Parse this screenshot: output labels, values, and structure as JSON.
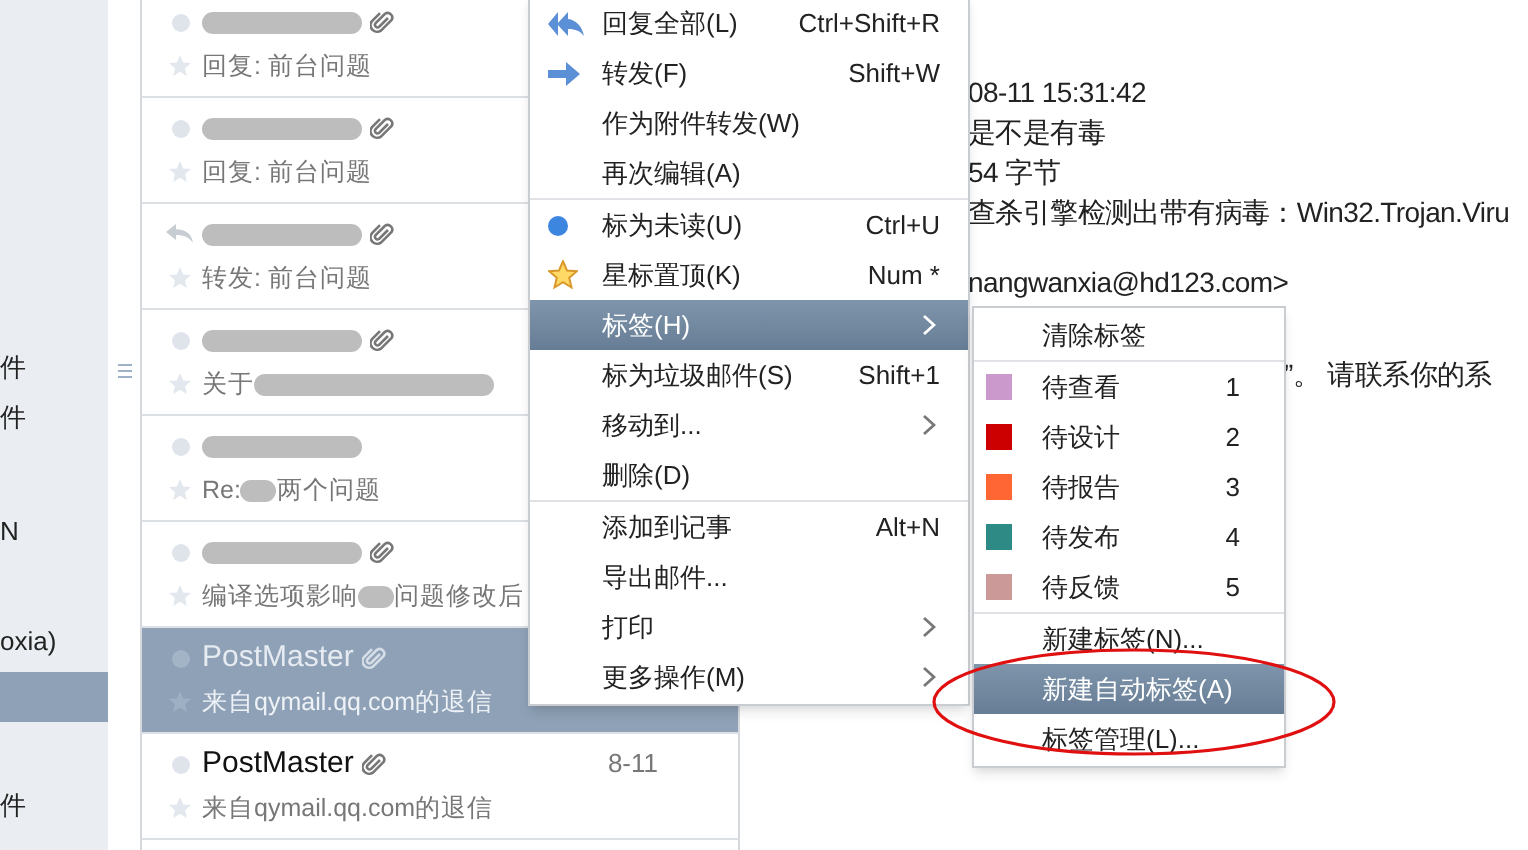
{
  "sidebar": {
    "items": [
      {
        "label": "件",
        "selected": false
      },
      {
        "label": "件",
        "selected": false
      },
      {
        "label": "N",
        "selected": false
      },
      {
        "label": "oxia)",
        "selected": false
      },
      {
        "selected": true
      },
      {
        "label": "件",
        "selected": false
      }
    ]
  },
  "mail_list": {
    "rows": [
      {
        "replied": false,
        "attachment": true,
        "subject": [
          "回复: 前台问题"
        ],
        "subject_tail_blurred": false,
        "selected": false
      },
      {
        "replied": false,
        "attachment": true,
        "subject": [
          "回复: 前台问题"
        ],
        "subject_tail_blurred": false,
        "selected": false
      },
      {
        "replied": true,
        "attachment": true,
        "subject": [
          "转发: 前台问题"
        ],
        "subject_tail_blurred": false,
        "selected": false
      },
      {
        "replied": false,
        "attachment": true,
        "subject": [
          "关于"
        ],
        "subject_tail_blurred": true,
        "selected": false
      },
      {
        "replied": false,
        "attachment": false,
        "subject": [
          "Re:",
          "两个问题"
        ],
        "subject_tail_blurred": false,
        "selected": false
      },
      {
        "replied": false,
        "attachment": true,
        "subject": [
          "编译选项影响",
          "问题修改后"
        ],
        "subject_tail_blurred": false,
        "selected": false
      },
      {
        "replied": false,
        "sender": "PostMaster",
        "attachment": true,
        "subject": [
          "来自qymail.qq.com的退信"
        ],
        "subject_tail_blurred": false,
        "selected": true
      },
      {
        "replied": false,
        "sender": "PostMaster",
        "attachment": true,
        "date": "8-11",
        "subject": [
          "来自qymail.qq.com的退信"
        ],
        "subject_tail_blurred": false,
        "selected": false
      }
    ]
  },
  "reading_pane": {
    "lines": [
      "08-11 15:31:42",
      "是不是有毒",
      "54 字节",
      "查杀引擎检测出带有病毒：Win32.Trojan.Viru",
      "nangwanxia@hd123.com>",
      "”。 请联系你的系"
    ]
  },
  "context_menu": {
    "groups": [
      [
        {
          "kind": "replyall",
          "label": "回复全部(L)",
          "shortcut": "Ctrl+Shift+R",
          "selected": false
        },
        {
          "kind": "forward",
          "label": "转发(F)",
          "shortcut": "Shift+W",
          "selected": false
        },
        {
          "kind": "plain",
          "label": "作为附件转发(W)",
          "selected": false
        },
        {
          "kind": "plain",
          "label": "再次编辑(A)",
          "selected": false
        }
      ],
      [
        {
          "kind": "unread",
          "label": "标为未读(U)",
          "shortcut": "Ctrl+U",
          "selected": false
        },
        {
          "kind": "star",
          "label": "星标置顶(K)",
          "shortcut": "Num *",
          "selected": false
        },
        {
          "kind": "plain",
          "label": "标签(H)",
          "submenu": true,
          "selected": true
        },
        {
          "kind": "plain",
          "label": "标为垃圾邮件(S)",
          "shortcut": "Shift+1",
          "selected": false
        },
        {
          "kind": "plain",
          "label": "移动到...",
          "submenu": true,
          "selected": false
        },
        {
          "kind": "plain",
          "label": "删除(D)",
          "selected": false
        }
      ],
      [
        {
          "kind": "plain",
          "label": "添加到记事",
          "shortcut": "Alt+N",
          "selected": false
        },
        {
          "kind": "plain",
          "label": "导出邮件...",
          "selected": false
        },
        {
          "kind": "plain",
          "label": "打印",
          "submenu": true,
          "selected": false
        },
        {
          "kind": "plain",
          "label": "更多操作(M)",
          "submenu": true,
          "selected": false
        }
      ]
    ]
  },
  "tag_submenu": {
    "groups": [
      [
        {
          "label": "清除标签",
          "selected": false
        }
      ],
      [
        {
          "label": "待查看",
          "shortcut": "1",
          "color": "#cc99cc",
          "selected": false
        },
        {
          "label": "待设计",
          "shortcut": "2",
          "color": "#cc0000",
          "selected": false
        },
        {
          "label": "待报告",
          "shortcut": "3",
          "color": "#ff6633",
          "selected": false
        },
        {
          "label": "待发布",
          "shortcut": "4",
          "color": "#2e8a85",
          "selected": false
        },
        {
          "label": "待反馈",
          "shortcut": "5",
          "color": "#cc9999",
          "selected": false
        }
      ],
      [
        {
          "label": "新建标签(N)...",
          "selected": false
        },
        {
          "label": "新建自动标签(A)",
          "selected": true
        },
        {
          "label": "标签管理(L)...",
          "selected": false
        }
      ]
    ]
  },
  "annotation": {
    "kind": "ellipse"
  }
}
